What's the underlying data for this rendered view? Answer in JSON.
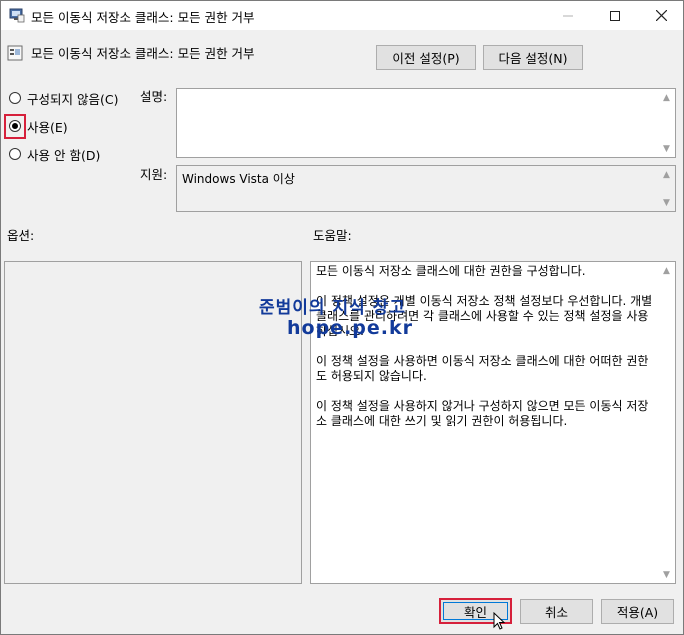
{
  "window": {
    "title": "모든 이동식 저장소 클래스: 모든 권한 거부",
    "controls": {
      "minimize": "minimize-icon",
      "maximize": "maximize-icon",
      "close": "close-icon"
    }
  },
  "header": {
    "policy_title": "모든 이동식 저장소 클래스: 모든 권한 거부",
    "prev_button": "이전 설정(P)",
    "next_button": "다음 설정(N)"
  },
  "options": {
    "not_configured": "구성되지 않음(C)",
    "enabled": "사용(E)",
    "disabled": "사용 안 함(D)",
    "selected": "enabled"
  },
  "comment": {
    "label": "설명:",
    "value": ""
  },
  "supported": {
    "label": "지원:",
    "value": "Windows Vista 이상"
  },
  "sections": {
    "options_label": "옵션:",
    "help_label": "도움말:"
  },
  "help_paragraphs": [
    "모든 이동식 저장소 클래스에 대한 권한을 구성합니다.",
    "이 정책 설정은 개별 이동식 저장소 정책 설정보다 우선합니다. 개별 클래스를 관리하려면 각 클래스에 사용할 수 있는 정책 설정을 사용하십시오.",
    "이 정책 설정을 사용하면 이동식 저장소 클래스에 대한 어떠한 권한도 허용되지 않습니다.",
    "이 정책 설정을 사용하지 않거나 구성하지 않으면 모든 이동식 저장소 클래스에 대한 쓰기 및 읽기 권한이 허용됩니다."
  ],
  "watermark": {
    "line1": "준범이의 지식 창고",
    "line2": "hope.pe.kr"
  },
  "footer": {
    "ok": "확인",
    "cancel": "취소",
    "apply": "적용(A)"
  },
  "colors": {
    "highlight": "#d6203b",
    "focus": "#0078d7",
    "watermark": "#123a9a"
  }
}
